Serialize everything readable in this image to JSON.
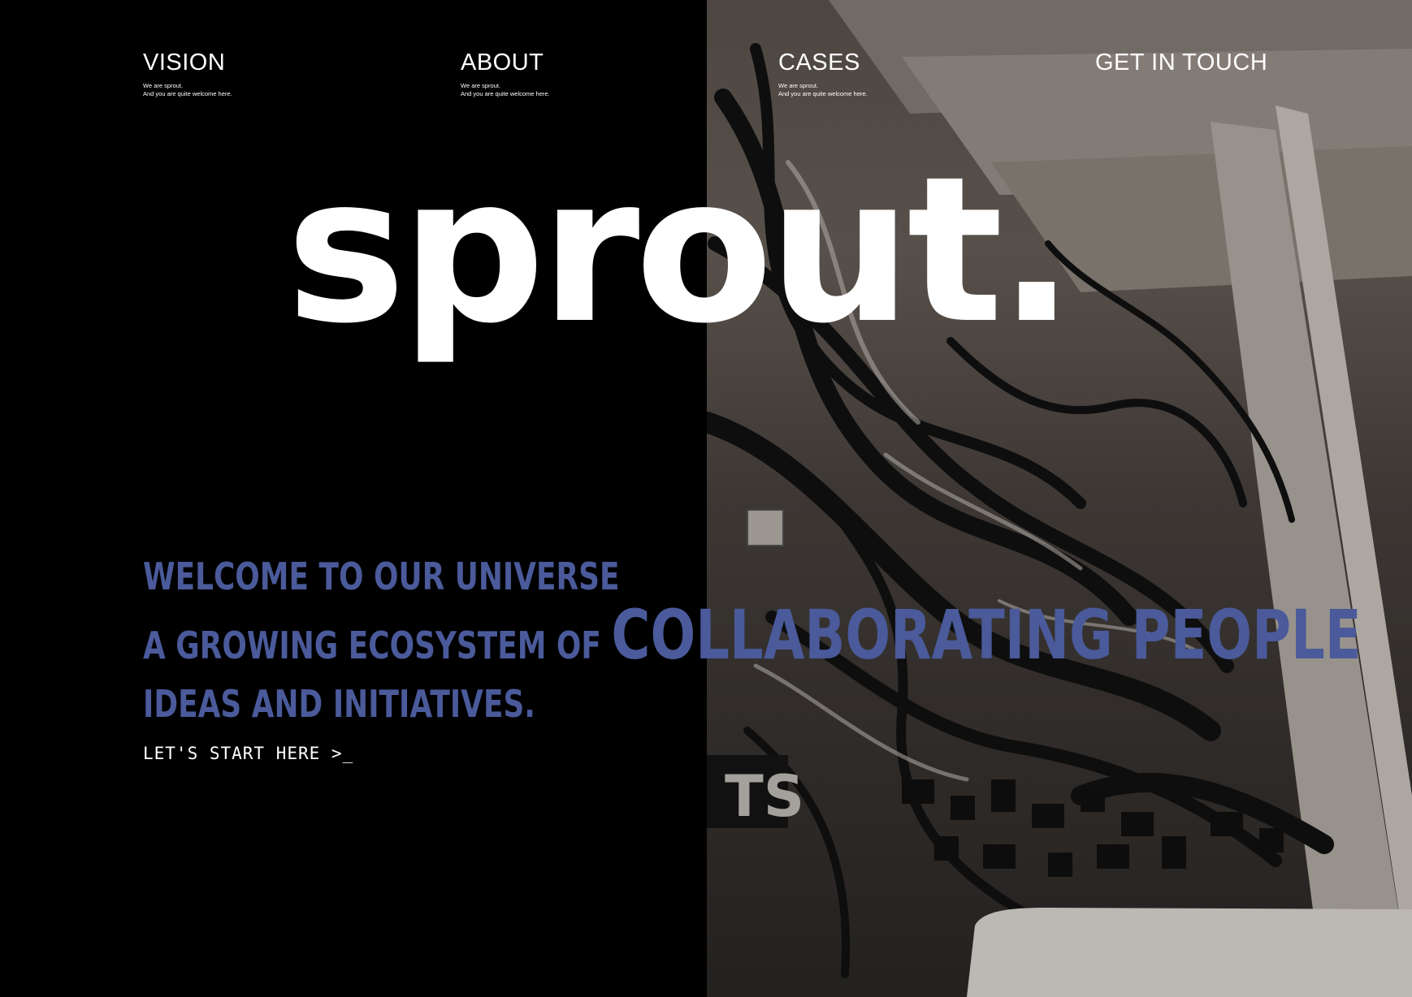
{
  "nav": {
    "items": [
      {
        "label": "VISION",
        "sub": "We are sprout.\nAnd you are quite welcome here."
      },
      {
        "label": "ABOUT",
        "sub": "We are sprout.\nAnd you are quite welcome here."
      },
      {
        "label": "CASES",
        "sub": "We are sprout.\nAnd you are quite welcome here."
      },
      {
        "label": "GET IN TOUCH"
      }
    ]
  },
  "logo": {
    "text": "sprout."
  },
  "hero": {
    "line1": "WELCOME TO OUR UNIVERSE",
    "line2_prefix": "A GROWING ECOSYSTEM OF ",
    "line2_emphasis": "COLLABORATING PEOPLE",
    "line3": "IDEAS AND INITIATIVES.",
    "cta": "LET'S START HERE >_"
  },
  "colors": {
    "background": "#000000",
    "text": "#ffffff",
    "accent": "#4a5a9a"
  }
}
